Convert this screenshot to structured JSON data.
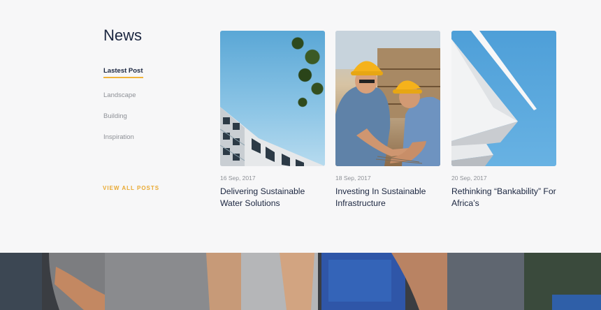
{
  "news": {
    "title": "News",
    "categories": [
      {
        "label": "Lastest Post",
        "active": true
      },
      {
        "label": "Landscape"
      },
      {
        "label": "Building"
      },
      {
        "label": "Inspiration"
      }
    ],
    "view_all_label": "VIEW ALL POSTS"
  },
  "posts": [
    {
      "date": "16 Sep, 2017",
      "title": "Delivering Sustainable Water Solutions"
    },
    {
      "date": "18 Sep, 2017",
      "title": "Investing In Sustainable Infrastructure"
    },
    {
      "date": "20 Sep, 2017",
      "title": "Rethinking “Bankability” For Africa’s"
    }
  ],
  "colors": {
    "accent": "#f0b33a",
    "heading": "#1b2640",
    "muted": "#8d9096",
    "background": "#f7f7f8"
  }
}
